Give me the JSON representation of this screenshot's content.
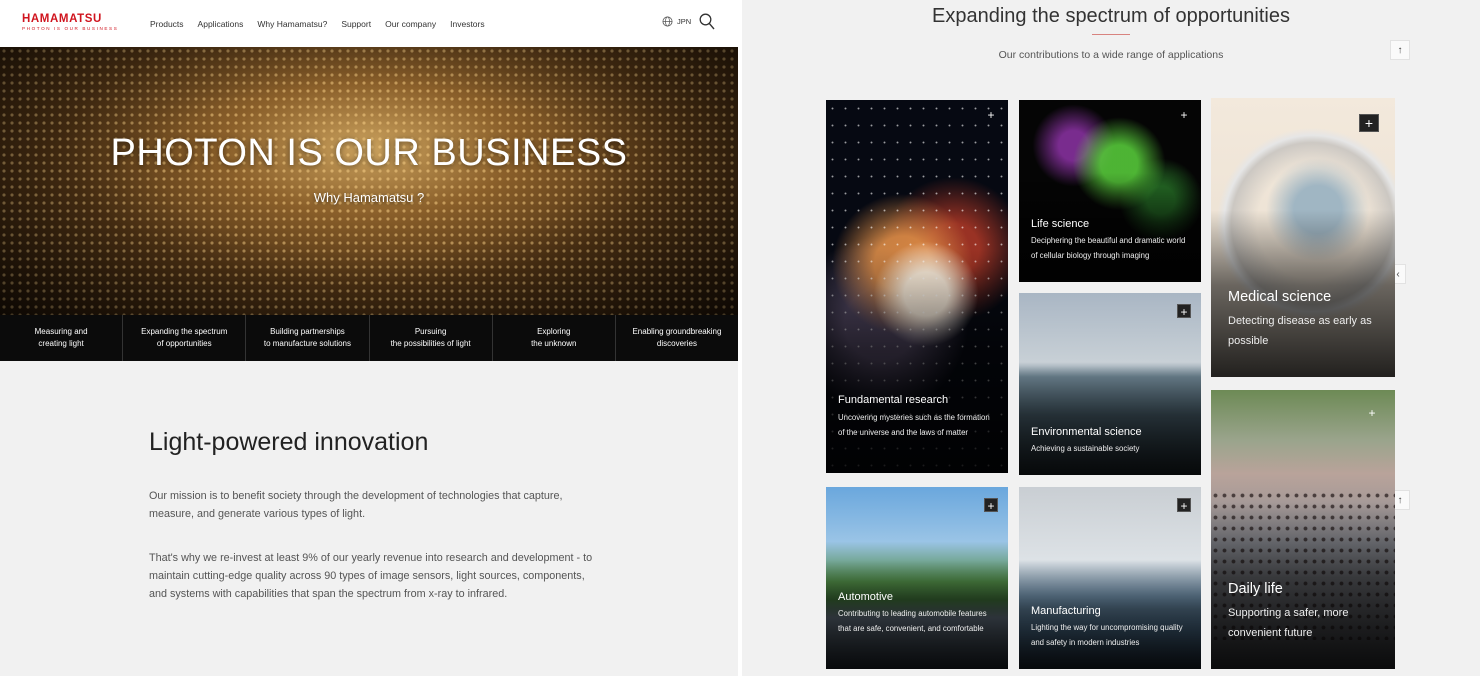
{
  "left": {
    "logo": {
      "main": "HAMAMATSU",
      "tagline": "PHOTON IS OUR BUSINESS"
    },
    "nav": [
      "Products",
      "Applications",
      "Why Hamamatsu?",
      "Support",
      "Our company",
      "Investors"
    ],
    "lang_label": "JPN",
    "hero": {
      "title": "PHOTON IS OUR BUSINESS",
      "subtitle": "Why Hamamatsu ?"
    },
    "tabs": [
      "Measuring and\ncreating light",
      "Expanding the spectrum\nof opportunities",
      "Building partnerships\nto manufacture solutions",
      "Pursuing\nthe possibilities of light",
      "Exploring\nthe unknown",
      "Enabling groundbreaking\ndiscoveries"
    ],
    "section_title": "Light-powered innovation",
    "paragraph1": "Our mission is to benefit society through the development of technologies that capture, measure, and generate various types of light.",
    "paragraph2": "That's why we re-invest at least 9% of our yearly revenue into research and development - to maintain cutting-edge quality across 90 types of image sensors, light sources, components, and systems with capabilities that span the spectrum from x-ray to infrared."
  },
  "right": {
    "title": "Expanding the spectrum of opportunities",
    "subtitle": "Our contributions to a wide range of applications",
    "up_arrow": "↑",
    "collapse_arrow": "‹",
    "plus": "+",
    "cards": {
      "fundamental": {
        "title": "Fundamental research",
        "desc": "Uncovering mysteries such as the formation of the universe and the laws of matter"
      },
      "life": {
        "title": "Life science",
        "desc": "Deciphering the beautiful and dramatic world of cellular biology through imaging"
      },
      "medical": {
        "title": "Medical science",
        "desc": "Detecting disease as early as possible"
      },
      "env": {
        "title": "Environmental science",
        "desc": "Achieving a sustainable society"
      },
      "auto": {
        "title": "Automotive",
        "desc": "Contributing to leading automobile features that are safe, convenient, and comfortable"
      },
      "manu": {
        "title": "Manufacturing",
        "desc": "Lighting the way for uncompromising quality and safety in modern industries"
      },
      "daily": {
        "title": "Daily life",
        "desc": "Supporting a safer, more convenient future"
      }
    }
  },
  "colors": {
    "brand_red": "#d0141e",
    "tab_bar": "#0b0b0b",
    "accent_rule": "#d8837f"
  }
}
